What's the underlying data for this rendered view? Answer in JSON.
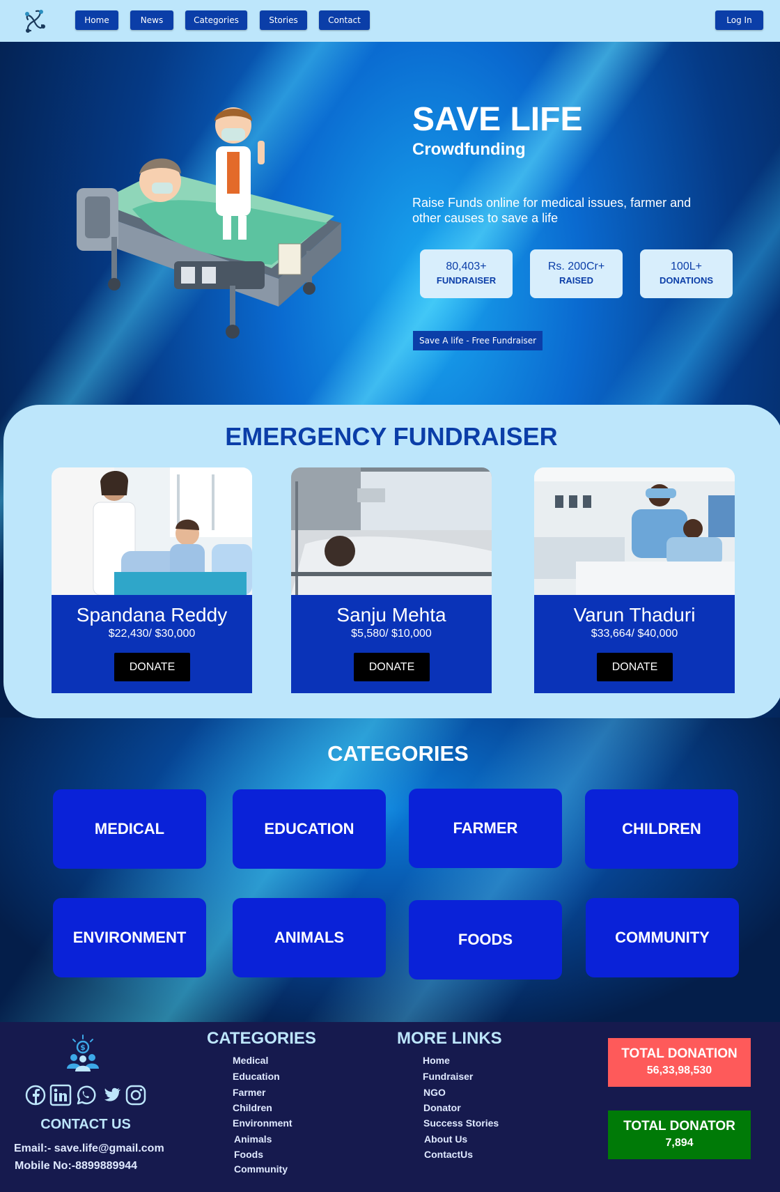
{
  "nav": {
    "items": [
      "Home",
      "News",
      "Categories",
      "Stories",
      "Contact"
    ],
    "login": "Log In"
  },
  "hero": {
    "title": "SAVE LIFE",
    "subtitle": "Crowdfunding",
    "description": "Raise Funds online for medical issues, farmer and other causes to save a life",
    "stats": [
      {
        "value": "80,403+",
        "label": "FUNDRAISER"
      },
      {
        "value": "Rs. 200Cr+",
        "label": "RAISED"
      },
      {
        "value": "100L+",
        "label": "DONATIONS"
      }
    ],
    "cta": "Save A life - Free Fundraiser"
  },
  "emergency": {
    "title": "EMERGENCY FUNDRAISER",
    "cards": [
      {
        "name": "Spandana Reddy",
        "amount": "$22,430/ $30,000",
        "button": "DONATE"
      },
      {
        "name": "Sanju Mehta",
        "amount": "$5,580/ $10,000",
        "button": "DONATE"
      },
      {
        "name": "Varun Thaduri",
        "amount": "$33,664/ $40,000",
        "button": "DONATE"
      }
    ]
  },
  "categories": {
    "title": "CATEGORIES",
    "items": [
      "MEDICAL",
      "EDUCATION",
      "FARMER",
      "CHILDREN",
      "ENVIRONMENT",
      "ANIMALS",
      "FOODS",
      "COMMUNITY"
    ]
  },
  "footer": {
    "contact_title": "CONTACT US",
    "email": "Email:- save.life@gmail.com",
    "mobile": "Mobile No:-8899889944",
    "social_icons": [
      "facebook-icon",
      "linkedin-icon",
      "whatsapp-icon",
      "twitter-icon",
      "instagram-icon"
    ],
    "categories_title": "CATEGORIES",
    "categories": [
      "Medical",
      "Education",
      "Farmer",
      "Children",
      "Environment",
      "Animals",
      "Foods",
      "Community"
    ],
    "links_title": "MORE LINKS",
    "links": [
      "Home",
      "Fundraiser",
      "NGO",
      "Donator",
      "Success Stories",
      "About Us",
      "ContactUs"
    ],
    "total_donation": {
      "label": "TOTAL DONATION",
      "value": "56,33,98,530",
      "color": "#fe5a5a"
    },
    "total_donator": {
      "label": "TOTAL DONATOR",
      "value": "7,894",
      "color": "#007a07"
    }
  }
}
